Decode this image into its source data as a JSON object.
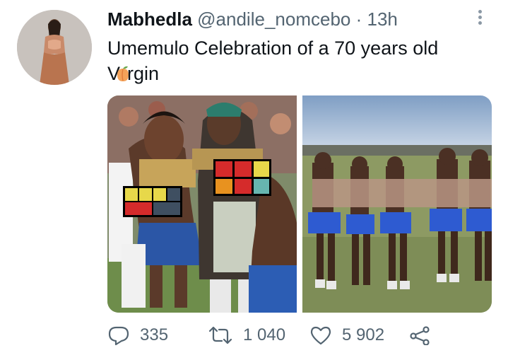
{
  "tweet": {
    "display_name": "Mabhedla",
    "handle": "@andile_nomcebo",
    "separator": "·",
    "time": "13h",
    "text_line1": "Umemulo Celebration of a 70 years old",
    "text_line2_prefix": "V",
    "text_line2_suffix": "rgin",
    "icons": {
      "more": "more-vertical-icon",
      "emoji": "peach-emoji-icon",
      "reply": "reply-icon",
      "retweet": "retweet-icon",
      "like": "heart-icon",
      "share": "share-icon"
    }
  },
  "actions": {
    "replies": "335",
    "retweets": "1 040",
    "likes": "5 902"
  },
  "colors": {
    "text": "#0f1419",
    "secondary": "#536471",
    "background": "#ffffff"
  }
}
